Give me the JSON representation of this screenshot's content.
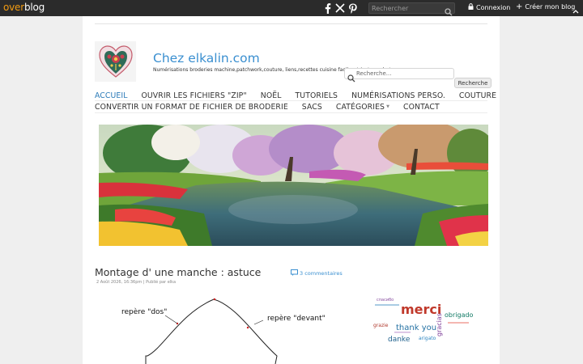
{
  "topbar": {
    "logo_part1": "over",
    "logo_part2": "blog",
    "search_placeholder": "Rechercher",
    "login_label": "Connexion",
    "create_label": "Créer mon blog",
    "icons": [
      "facebook-icon",
      "x-icon",
      "pinterest-icon",
      "search-icon",
      "lock-icon",
      "plus-icon",
      "chevron-up-icon"
    ]
  },
  "header": {
    "title": "Chez elkalin.com",
    "description": "Numérisations broderies machine,patchwork,couture, liens,recettes cuisine faciles, tricot, crochet",
    "search_placeholder": "Recherche...",
    "search_button": "Recherche"
  },
  "nav": {
    "row1": [
      "ACCUEIL",
      "OUVRIR LES FICHIERS \"ZIP\"",
      "NOËL",
      "TUTORIELS",
      "NUMÉRISATIONS PERSO.",
      "COUTURE"
    ],
    "row2": [
      "CONVERTIR UN FORMAT DE FICHIER DE BRODERIE",
      "SACS",
      "CATÉGORIES",
      "CONTACT"
    ],
    "active": "ACCUEIL"
  },
  "post": {
    "title": "Montage d' une manche : astuce",
    "meta": "2 Août 2026, 16:36pm | Publié par elka",
    "comments": "3 commentaires",
    "diagram_labels": {
      "back": "repère \"dos\"",
      "front": "repère \"devant\""
    },
    "wordcloud_words": [
      "merci",
      "thank you",
      "danke",
      "gracias",
      "obrigado",
      "grazie",
      "arigato",
      "спасибо"
    ]
  },
  "colors": {
    "topbar_bg": "#2b2b2b",
    "accent": "#3a8fd0",
    "brand_orange": "#f39c12",
    "page_bg": "#efefef"
  }
}
